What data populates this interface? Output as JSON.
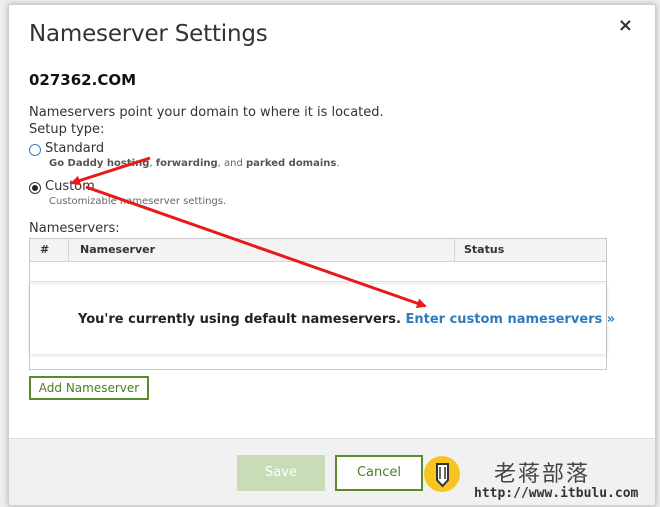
{
  "dialog": {
    "title": "Nameserver Settings",
    "close_label": "×",
    "domain": "027362.COM",
    "description": "Nameservers point your domain to where it is located.",
    "setup_type_label": "Setup type:"
  },
  "options": {
    "standard": {
      "label": "Standard",
      "sub_bold1": "Go Daddy hosting",
      "sub_sep1": ", ",
      "sub_bold2": "forwarding",
      "sub_sep2": ", and ",
      "sub_bold3": "parked domains",
      "sub_end": ".",
      "selected": false
    },
    "custom": {
      "label": "Custom",
      "sub": "Customizable nameserver settings.",
      "selected": true
    }
  },
  "nameservers": {
    "label": "Nameservers:",
    "columns": [
      "#",
      "Nameserver",
      "Status"
    ],
    "message": "You're currently using default nameservers.",
    "link": "Enter custom nameservers »"
  },
  "buttons": {
    "add": "Add Nameserver",
    "save": "Save",
    "cancel": "Cancel"
  },
  "watermark": {
    "title": "老蒋部落",
    "url": "http://www.itbulu.com"
  },
  "colors": {
    "accent_green": "#5a8a2b",
    "link_blue": "#2f7bbf",
    "annotation_red": "#e8191b"
  }
}
